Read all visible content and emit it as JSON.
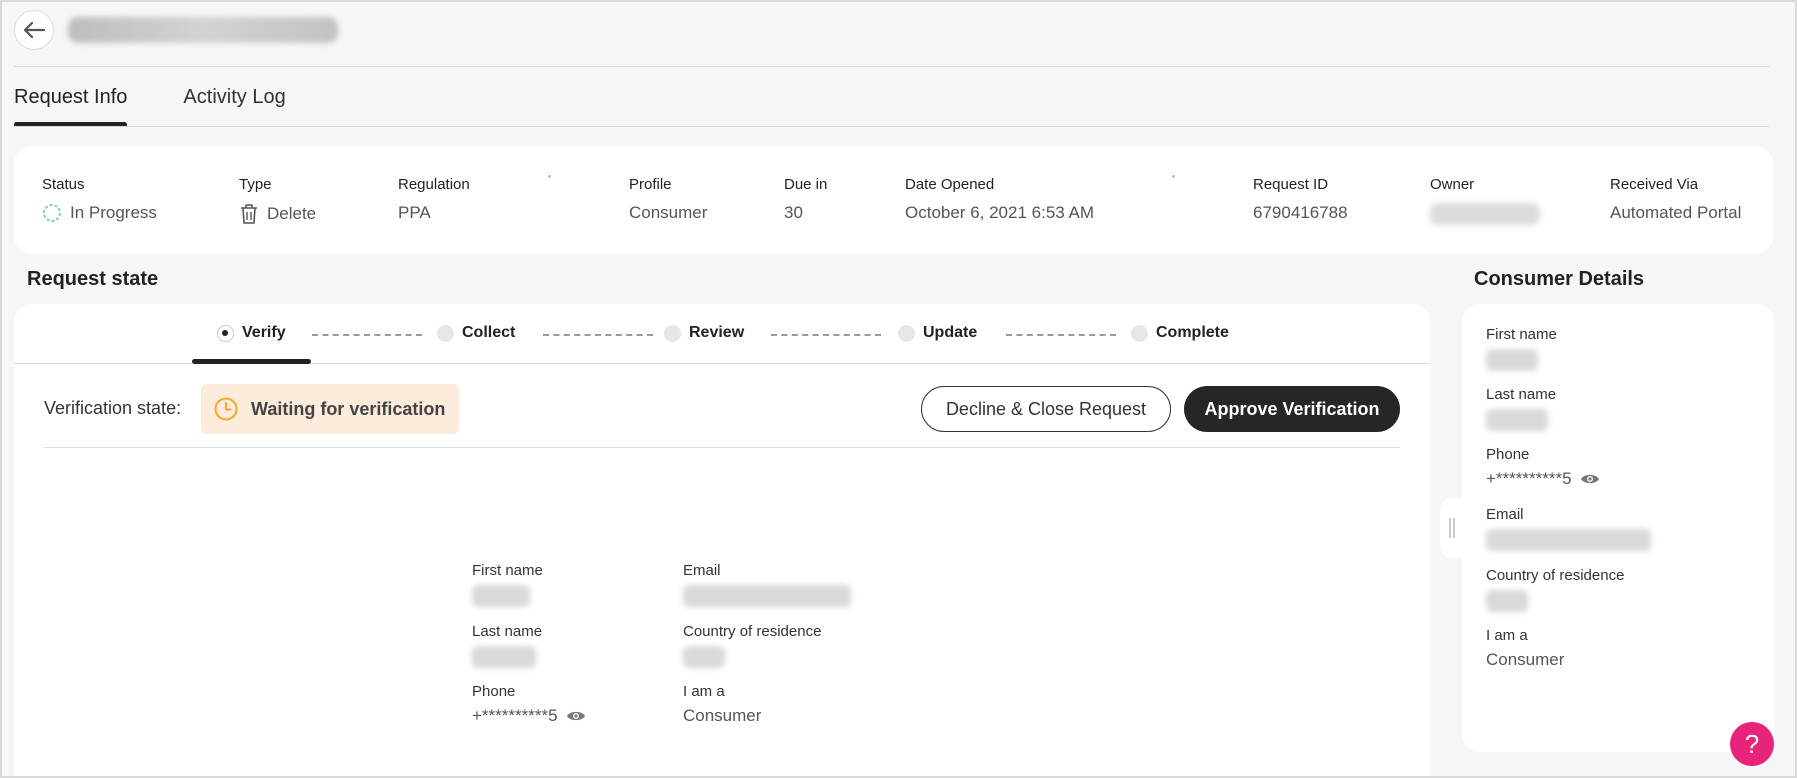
{
  "tabs": [
    {
      "label": "Request Info"
    },
    {
      "label": "Activity Log"
    }
  ],
  "summary": {
    "status": {
      "label": "Status",
      "value": "In Progress"
    },
    "type": {
      "label": "Type",
      "value": "Delete"
    },
    "regulation": {
      "label": "Regulation",
      "value": "PPA"
    },
    "profile": {
      "label": "Profile",
      "value": "Consumer"
    },
    "due_in": {
      "label": "Due in",
      "value": "30"
    },
    "date_opened": {
      "label": "Date Opened",
      "value": "October 6, 2021 6:53 AM"
    },
    "request_id": {
      "label": "Request ID",
      "value": "6790416788"
    },
    "owner": {
      "label": "Owner"
    },
    "received_via": {
      "label": "Received Via",
      "value": "Automated Portal"
    }
  },
  "request_state": {
    "title": "Request state",
    "steps": [
      {
        "label": "Verify"
      },
      {
        "label": "Collect"
      },
      {
        "label": "Review"
      },
      {
        "label": "Update"
      },
      {
        "label": "Complete"
      }
    ],
    "verification_label": "Verification state:",
    "verification_status": "Waiting for verification",
    "decline_label": "Decline & Close Request",
    "approve_label": "Approve Verification",
    "fields": {
      "first_name": {
        "label": "First name"
      },
      "email": {
        "label": "Email"
      },
      "last_name": {
        "label": "Last name"
      },
      "country": {
        "label": "Country of residence"
      },
      "phone": {
        "label": "Phone",
        "value": "+**********5"
      },
      "i_am_a": {
        "label": "I am a",
        "value": "Consumer"
      }
    }
  },
  "consumer_details": {
    "title": "Consumer Details",
    "first_name": {
      "label": "First name"
    },
    "last_name": {
      "label": "Last name"
    },
    "phone": {
      "label": "Phone",
      "value": "+**********5"
    },
    "email": {
      "label": "Email"
    },
    "country": {
      "label": "Country of residence"
    },
    "i_am_a": {
      "label": "I am a",
      "value": "Consumer"
    }
  },
  "help": {
    "label": "?"
  },
  "colors": {
    "accent_dark": "#262626",
    "status_pending_bg": "#fdebdc",
    "status_pending_icon": "#f5a623",
    "in_progress_ring": "#7fd3a6",
    "help_pink": "#e8237a"
  },
  "icons": {
    "back": "arrow-left-icon",
    "status": "progress-ring-icon",
    "type": "trash-icon",
    "clock": "clock-icon",
    "eye": "eye-icon",
    "drag": "drag-handle-icon",
    "help": "question-icon"
  }
}
